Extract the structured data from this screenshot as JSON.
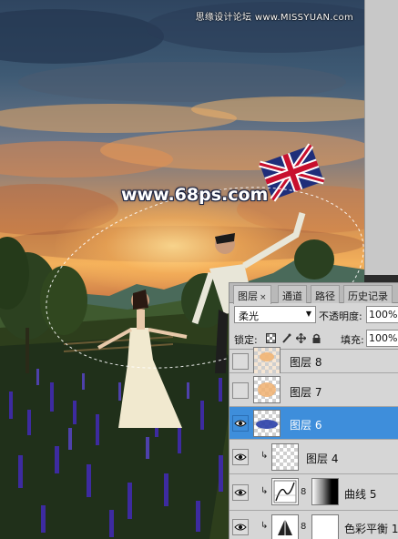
{
  "watermark_top": "思缘设计论坛 www.MISSYUAN.com",
  "watermark_center": "www.68ps.com",
  "layers_panel": {
    "tabs": [
      {
        "label": "图层",
        "active": true,
        "close": "×"
      },
      {
        "label": "通道",
        "active": false
      },
      {
        "label": "路径",
        "active": false
      },
      {
        "label": "历史记录",
        "active": false
      }
    ],
    "blend_mode": "柔光",
    "opacity_label": "不透明度:",
    "opacity_value": "100%",
    "lock_label": "锁定:",
    "fill_label": "填充:",
    "fill_value": "100%",
    "layers": [
      {
        "name": "图层 8",
        "visible": false,
        "selected": false
      },
      {
        "name": "图层 7",
        "visible": false,
        "selected": false
      },
      {
        "name": "图层 6",
        "visible": true,
        "selected": true
      },
      {
        "name": "图层 4",
        "visible": true,
        "selected": false,
        "clipped": true
      },
      {
        "name": "曲线 5",
        "visible": true,
        "selected": false,
        "clipped": true,
        "adjustment": "curves-icon"
      },
      {
        "name": "色彩平衡 1",
        "visible": true,
        "selected": false,
        "clipped": true,
        "adjustment": "color-balance-icon"
      }
    ]
  },
  "colors": {
    "selection": "#3e8edb",
    "panel_bg": "#d6d6d6"
  }
}
